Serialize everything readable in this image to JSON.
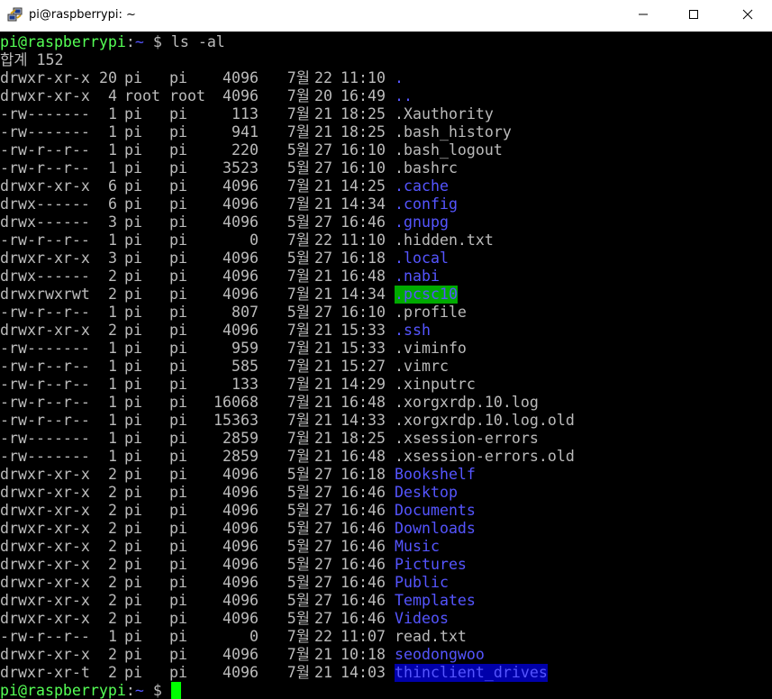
{
  "window": {
    "title": "pi@raspberrypi: ~"
  },
  "prompt": {
    "host": "pi@raspberrypi",
    "sep": ":",
    "path": "~",
    "symbol": " $ ",
    "command": "ls -al"
  },
  "total_line": "합계 152",
  "listing": [
    {
      "perm": "drwxr-xr-x",
      "links": "20",
      "owner": "pi",
      "group": "pi",
      "size": "4096",
      "month": "7월",
      "day": "22",
      "time": "11:10",
      "name": ".",
      "style": "dir"
    },
    {
      "perm": "drwxr-xr-x",
      "links": "4",
      "owner": "root",
      "group": "root",
      "size": "4096",
      "month": "7월",
      "day": "20",
      "time": "16:49",
      "name": "..",
      "style": "dir"
    },
    {
      "perm": "-rw-------",
      "links": "1",
      "owner": "pi",
      "group": "pi",
      "size": "113",
      "month": "7월",
      "day": "21",
      "time": "18:25",
      "name": ".Xauthority",
      "style": "file"
    },
    {
      "perm": "-rw-------",
      "links": "1",
      "owner": "pi",
      "group": "pi",
      "size": "941",
      "month": "7월",
      "day": "21",
      "time": "18:25",
      "name": ".bash_history",
      "style": "file"
    },
    {
      "perm": "-rw-r--r--",
      "links": "1",
      "owner": "pi",
      "group": "pi",
      "size": "220",
      "month": "5월",
      "day": "27",
      "time": "16:10",
      "name": ".bash_logout",
      "style": "file"
    },
    {
      "perm": "-rw-r--r--",
      "links": "1",
      "owner": "pi",
      "group": "pi",
      "size": "3523",
      "month": "5월",
      "day": "27",
      "time": "16:10",
      "name": ".bashrc",
      "style": "file"
    },
    {
      "perm": "drwxr-xr-x",
      "links": "6",
      "owner": "pi",
      "group": "pi",
      "size": "4096",
      "month": "7월",
      "day": "21",
      "time": "14:25",
      "name": ".cache",
      "style": "dir"
    },
    {
      "perm": "drwx------",
      "links": "6",
      "owner": "pi",
      "group": "pi",
      "size": "4096",
      "month": "7월",
      "day": "21",
      "time": "14:34",
      "name": ".config",
      "style": "dir"
    },
    {
      "perm": "drwx------",
      "links": "3",
      "owner": "pi",
      "group": "pi",
      "size": "4096",
      "month": "5월",
      "day": "27",
      "time": "16:46",
      "name": ".gnupg",
      "style": "dir"
    },
    {
      "perm": "-rw-r--r--",
      "links": "1",
      "owner": "pi",
      "group": "pi",
      "size": "0",
      "month": "7월",
      "day": "22",
      "time": "11:10",
      "name": ".hidden.txt",
      "style": "file"
    },
    {
      "perm": "drwxr-xr-x",
      "links": "3",
      "owner": "pi",
      "group": "pi",
      "size": "4096",
      "month": "5월",
      "day": "27",
      "time": "16:18",
      "name": ".local",
      "style": "dir"
    },
    {
      "perm": "drwx------",
      "links": "2",
      "owner": "pi",
      "group": "pi",
      "size": "4096",
      "month": "7월",
      "day": "21",
      "time": "16:48",
      "name": ".nabi",
      "style": "dir"
    },
    {
      "perm": "drwxrwxrwt",
      "links": "2",
      "owner": "pi",
      "group": "pi",
      "size": "4096",
      "month": "7월",
      "day": "21",
      "time": "14:34",
      "name": ".pcsc10",
      "style": "sticky"
    },
    {
      "perm": "-rw-r--r--",
      "links": "1",
      "owner": "pi",
      "group": "pi",
      "size": "807",
      "month": "5월",
      "day": "27",
      "time": "16:10",
      "name": ".profile",
      "style": "file"
    },
    {
      "perm": "drwxr-xr-x",
      "links": "2",
      "owner": "pi",
      "group": "pi",
      "size": "4096",
      "month": "7월",
      "day": "21",
      "time": "15:33",
      "name": ".ssh",
      "style": "dir"
    },
    {
      "perm": "-rw-------",
      "links": "1",
      "owner": "pi",
      "group": "pi",
      "size": "959",
      "month": "7월",
      "day": "21",
      "time": "15:33",
      "name": ".viminfo",
      "style": "file"
    },
    {
      "perm": "-rw-r--r--",
      "links": "1",
      "owner": "pi",
      "group": "pi",
      "size": "585",
      "month": "7월",
      "day": "21",
      "time": "15:27",
      "name": ".vimrc",
      "style": "file"
    },
    {
      "perm": "-rw-r--r--",
      "links": "1",
      "owner": "pi",
      "group": "pi",
      "size": "133",
      "month": "7월",
      "day": "21",
      "time": "14:29",
      "name": ".xinputrc",
      "style": "file"
    },
    {
      "perm": "-rw-r--r--",
      "links": "1",
      "owner": "pi",
      "group": "pi",
      "size": "16068",
      "month": "7월",
      "day": "21",
      "time": "16:48",
      "name": ".xorgxrdp.10.log",
      "style": "file"
    },
    {
      "perm": "-rw-r--r--",
      "links": "1",
      "owner": "pi",
      "group": "pi",
      "size": "15363",
      "month": "7월",
      "day": "21",
      "time": "14:33",
      "name": ".xorgxrdp.10.log.old",
      "style": "file"
    },
    {
      "perm": "-rw-------",
      "links": "1",
      "owner": "pi",
      "group": "pi",
      "size": "2859",
      "month": "7월",
      "day": "21",
      "time": "18:25",
      "name": ".xsession-errors",
      "style": "file"
    },
    {
      "perm": "-rw-------",
      "links": "1",
      "owner": "pi",
      "group": "pi",
      "size": "2859",
      "month": "7월",
      "day": "21",
      "time": "16:48",
      "name": ".xsession-errors.old",
      "style": "file"
    },
    {
      "perm": "drwxr-xr-x",
      "links": "2",
      "owner": "pi",
      "group": "pi",
      "size": "4096",
      "month": "5월",
      "day": "27",
      "time": "16:18",
      "name": "Bookshelf",
      "style": "dir"
    },
    {
      "perm": "drwxr-xr-x",
      "links": "2",
      "owner": "pi",
      "group": "pi",
      "size": "4096",
      "month": "5월",
      "day": "27",
      "time": "16:46",
      "name": "Desktop",
      "style": "dir"
    },
    {
      "perm": "drwxr-xr-x",
      "links": "2",
      "owner": "pi",
      "group": "pi",
      "size": "4096",
      "month": "5월",
      "day": "27",
      "time": "16:46",
      "name": "Documents",
      "style": "dir"
    },
    {
      "perm": "drwxr-xr-x",
      "links": "2",
      "owner": "pi",
      "group": "pi",
      "size": "4096",
      "month": "5월",
      "day": "27",
      "time": "16:46",
      "name": "Downloads",
      "style": "dir"
    },
    {
      "perm": "drwxr-xr-x",
      "links": "2",
      "owner": "pi",
      "group": "pi",
      "size": "4096",
      "month": "5월",
      "day": "27",
      "time": "16:46",
      "name": "Music",
      "style": "dir"
    },
    {
      "perm": "drwxr-xr-x",
      "links": "2",
      "owner": "pi",
      "group": "pi",
      "size": "4096",
      "month": "5월",
      "day": "27",
      "time": "16:46",
      "name": "Pictures",
      "style": "dir"
    },
    {
      "perm": "drwxr-xr-x",
      "links": "2",
      "owner": "pi",
      "group": "pi",
      "size": "4096",
      "month": "5월",
      "day": "27",
      "time": "16:46",
      "name": "Public",
      "style": "dir"
    },
    {
      "perm": "drwxr-xr-x",
      "links": "2",
      "owner": "pi",
      "group": "pi",
      "size": "4096",
      "month": "5월",
      "day": "27",
      "time": "16:46",
      "name": "Templates",
      "style": "dir"
    },
    {
      "perm": "drwxr-xr-x",
      "links": "2",
      "owner": "pi",
      "group": "pi",
      "size": "4096",
      "month": "5월",
      "day": "27",
      "time": "16:46",
      "name": "Videos",
      "style": "dir"
    },
    {
      "perm": "-rw-r--r--",
      "links": "1",
      "owner": "pi",
      "group": "pi",
      "size": "0",
      "month": "7월",
      "day": "22",
      "time": "11:07",
      "name": "read.txt",
      "style": "file"
    },
    {
      "perm": "drwxr-xr-x",
      "links": "2",
      "owner": "pi",
      "group": "pi",
      "size": "4096",
      "month": "7월",
      "day": "21",
      "time": "10:18",
      "name": "seodongwoo",
      "style": "dir"
    },
    {
      "perm": "drwxr-xr-t",
      "links": "2",
      "owner": "pi",
      "group": "pi",
      "size": "4096",
      "month": "7월",
      "day": "21",
      "time": "14:03",
      "name": "thinclient_drives",
      "style": "mount"
    }
  ],
  "colors": {
    "background": "#000000",
    "text": "#bbbbbb",
    "prompt_host": "#55ff55",
    "directory": "#5555ff",
    "sticky_bg": "#00aa00",
    "mount_bg": "#0000aa",
    "cursor": "#00ff00"
  },
  "icons": {
    "app": "putty-icon",
    "minimize": "minimize-icon",
    "maximize": "maximize-icon",
    "close": "close-icon"
  }
}
